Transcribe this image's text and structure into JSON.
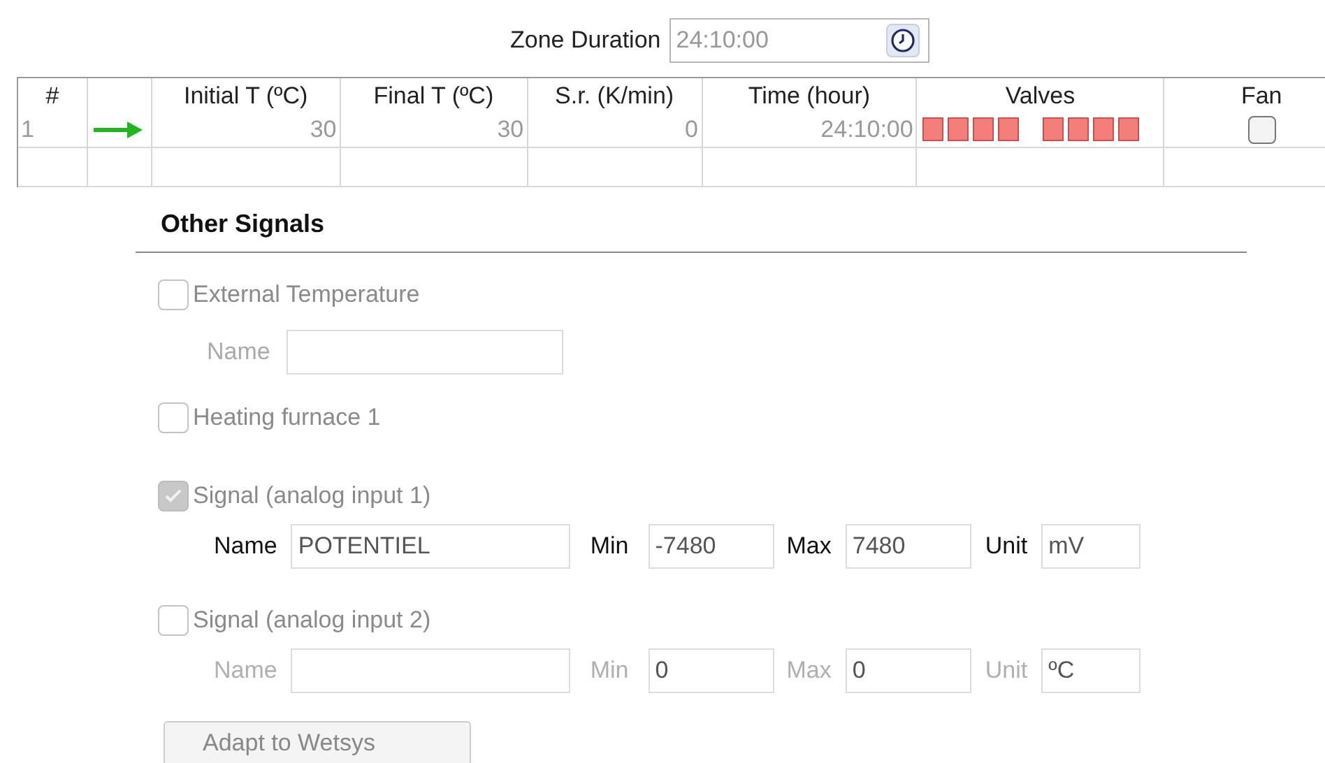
{
  "zone_duration": {
    "label": "Zone Duration",
    "value": "24:10:00"
  },
  "table": {
    "columns": [
      "#",
      "Initial T (ºC)",
      "Final T (ºC)",
      "S.r. (K/min)",
      "Time (hour)",
      "Valves",
      "Fan"
    ],
    "rows": [
      {
        "number": "1",
        "current": true,
        "initial_t": "30",
        "final_t": "30",
        "rate": "0",
        "time": "24:10:00",
        "valves": [
          {
            "on": true
          },
          {
            "on": true
          },
          {
            "on": true
          },
          {
            "on": true
          },
          {
            "on": true
          },
          {
            "on": true
          },
          {
            "on": true
          },
          {
            "on": true
          }
        ],
        "fan": {
          "checked": false
        }
      }
    ]
  },
  "other_signals": {
    "title": "Other Signals",
    "signals": [
      {
        "kind": "name_only",
        "label": "External Temperature",
        "checked": false,
        "fields": [
          {
            "label": "Name"
          }
        ]
      },
      {
        "kind": "plain",
        "label": "Heating furnace 1",
        "checked": false
      },
      {
        "kind": "analog",
        "label": "Signal (analog input 1)",
        "checked": true,
        "fields": [
          {
            "label": "Name",
            "value": "POTENTIEL"
          },
          {
            "label": "Min",
            "value": "-7480"
          },
          {
            "label": "Max",
            "value": "7480"
          },
          {
            "label": "Unit",
            "value": "mV"
          }
        ]
      },
      {
        "kind": "analog",
        "label": "Signal (analog input 2)",
        "checked": false,
        "fields": [
          {
            "label": "Name"
          },
          {
            "label": "Min",
            "value": "0"
          },
          {
            "label": "Max",
            "value": "0"
          },
          {
            "label": "Unit",
            "value": "ºC"
          }
        ]
      }
    ],
    "button": "Adapt to Wetsys"
  }
}
